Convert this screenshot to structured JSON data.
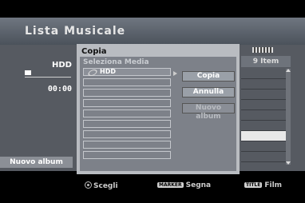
{
  "title": "Lista Musicale",
  "left": {
    "source": "HDD",
    "time": "00:00",
    "nuovo_album": "Nuovo album"
  },
  "right": {
    "count": "9 Item"
  },
  "dialog": {
    "title": "Copia",
    "subtitle": "Seleziona  Media",
    "slots": [
      "HDD",
      "",
      "",
      "",
      "",
      "",
      "",
      "",
      ""
    ],
    "buttons": {
      "copia": "Copia",
      "annulla": "Annulla",
      "nuovo_album": "Nuovo album"
    }
  },
  "footer": {
    "choose": "Scegli",
    "marker_tag": "MARKER",
    "mark": "Segna",
    "title_tag": "TITLE",
    "film": "Film"
  }
}
